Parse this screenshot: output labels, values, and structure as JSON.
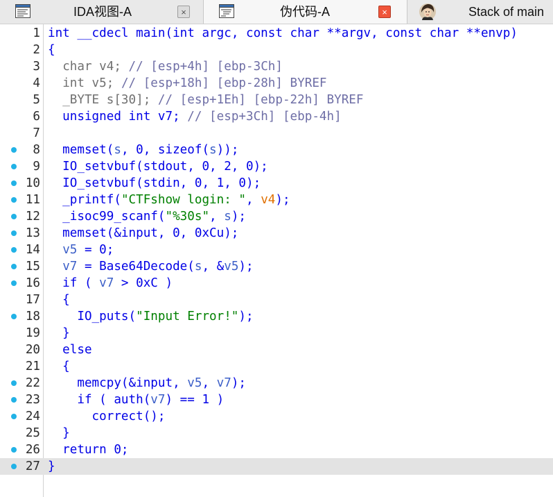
{
  "tabs": [
    {
      "label": "IDA视图-A",
      "icon": "disassembly-view-icon",
      "active": false
    },
    {
      "label": "伪代码-A",
      "icon": "pseudocode-view-icon",
      "active": true
    },
    {
      "label": "Stack of main",
      "icon": "portrait-icon",
      "active": false
    }
  ],
  "tab_close_glyph": "×",
  "code": [
    {
      "n": "1",
      "bp": false,
      "tokens": [
        [
          "tp",
          "int"
        ],
        [
          "pl",
          " __cdecl main(int argc, const char **argv, const char **envp)"
        ]
      ]
    },
    {
      "n": "2",
      "bp": false,
      "tokens": [
        [
          "pl",
          "{"
        ]
      ]
    },
    {
      "n": "3",
      "bp": false,
      "tokens": [
        [
          "pl",
          "  "
        ],
        [
          "gray",
          "char v4; "
        ],
        [
          "cm",
          "// [esp+4h] [ebp-3Ch]"
        ]
      ]
    },
    {
      "n": "4",
      "bp": false,
      "tokens": [
        [
          "pl",
          "  "
        ],
        [
          "gray",
          "int v5; "
        ],
        [
          "cm",
          "// [esp+18h] [ebp-28h] BYREF"
        ]
      ]
    },
    {
      "n": "5",
      "bp": false,
      "tokens": [
        [
          "pl",
          "  "
        ],
        [
          "gray",
          "_BYTE s[30]; "
        ],
        [
          "cm",
          "// [esp+1Eh] [ebp-22h] BYREF"
        ]
      ]
    },
    {
      "n": "6",
      "bp": false,
      "tokens": [
        [
          "pl",
          "  unsigned int v7; "
        ],
        [
          "cm",
          "// [esp+3Ch] [ebp-4h]"
        ]
      ]
    },
    {
      "n": "7",
      "bp": false,
      "tokens": [
        [
          "pl",
          ""
        ]
      ]
    },
    {
      "n": "8",
      "bp": true,
      "tokens": [
        [
          "pl",
          "  memset("
        ],
        [
          "vr",
          "s"
        ],
        [
          "pl",
          ", 0, sizeof("
        ],
        [
          "vr",
          "s"
        ],
        [
          "pl",
          "));"
        ]
      ]
    },
    {
      "n": "9",
      "bp": true,
      "tokens": [
        [
          "pl",
          "  IO_setvbuf(stdout, 0, 2, 0);"
        ]
      ]
    },
    {
      "n": "10",
      "bp": true,
      "tokens": [
        [
          "pl",
          "  IO_setvbuf(stdin, 0, 1, 0);"
        ]
      ]
    },
    {
      "n": "11",
      "bp": true,
      "tokens": [
        [
          "pl",
          "  _printf("
        ],
        [
          "str",
          "\"CTFshow login: \""
        ],
        [
          "pl",
          ", "
        ],
        [
          "vr2",
          "v4"
        ],
        [
          "pl",
          ");"
        ]
      ]
    },
    {
      "n": "12",
      "bp": true,
      "tokens": [
        [
          "pl",
          "  _isoc99_scanf("
        ],
        [
          "str",
          "\"%30s\""
        ],
        [
          "pl",
          ", "
        ],
        [
          "vr",
          "s"
        ],
        [
          "pl",
          ");"
        ]
      ]
    },
    {
      "n": "13",
      "bp": true,
      "tokens": [
        [
          "pl",
          "  memset(&input, 0, 0xCu);"
        ]
      ]
    },
    {
      "n": "14",
      "bp": true,
      "tokens": [
        [
          "pl",
          "  "
        ],
        [
          "vr",
          "v5"
        ],
        [
          "pl",
          " = 0;"
        ]
      ]
    },
    {
      "n": "15",
      "bp": true,
      "tokens": [
        [
          "pl",
          "  "
        ],
        [
          "vr",
          "v7"
        ],
        [
          "pl",
          " = Base64Decode("
        ],
        [
          "vr",
          "s"
        ],
        [
          "pl",
          ", &"
        ],
        [
          "vr",
          "v5"
        ],
        [
          "pl",
          ");"
        ]
      ]
    },
    {
      "n": "16",
      "bp": true,
      "tokens": [
        [
          "pl",
          "  if ( "
        ],
        [
          "vr",
          "v7"
        ],
        [
          "pl",
          " > 0xC )"
        ]
      ]
    },
    {
      "n": "17",
      "bp": false,
      "tokens": [
        [
          "pl",
          "  {"
        ]
      ]
    },
    {
      "n": "18",
      "bp": true,
      "tokens": [
        [
          "pl",
          "    IO_puts("
        ],
        [
          "str",
          "\"Input Error!\""
        ],
        [
          "pl",
          ");"
        ]
      ]
    },
    {
      "n": "19",
      "bp": false,
      "tokens": [
        [
          "pl",
          "  }"
        ]
      ]
    },
    {
      "n": "20",
      "bp": false,
      "tokens": [
        [
          "pl",
          "  else"
        ]
      ]
    },
    {
      "n": "21",
      "bp": false,
      "tokens": [
        [
          "pl",
          "  {"
        ]
      ]
    },
    {
      "n": "22",
      "bp": true,
      "tokens": [
        [
          "pl",
          "    memcpy(&input, "
        ],
        [
          "vr",
          "v5"
        ],
        [
          "pl",
          ", "
        ],
        [
          "vr",
          "v7"
        ],
        [
          "pl",
          ");"
        ]
      ]
    },
    {
      "n": "23",
      "bp": true,
      "tokens": [
        [
          "pl",
          "    if ( auth("
        ],
        [
          "vr",
          "v7"
        ],
        [
          "pl",
          ") == 1 )"
        ]
      ]
    },
    {
      "n": "24",
      "bp": true,
      "tokens": [
        [
          "pl",
          "      correct();"
        ]
      ]
    },
    {
      "n": "25",
      "bp": false,
      "tokens": [
        [
          "pl",
          "  }"
        ]
      ]
    },
    {
      "n": "26",
      "bp": true,
      "tokens": [
        [
          "pl",
          "  return 0;"
        ]
      ]
    },
    {
      "n": "27",
      "bp": true,
      "current": true,
      "tokens": [
        [
          "pl",
          "}"
        ]
      ]
    }
  ],
  "colors": {
    "keyword": "#0000e6",
    "local_var": "#3c5fc8",
    "global_var": "#e07000",
    "comment": "#6e6ea6",
    "string": "#008000",
    "breakpoint_dot": "#21b2e6",
    "close_active": "#f0553a"
  }
}
